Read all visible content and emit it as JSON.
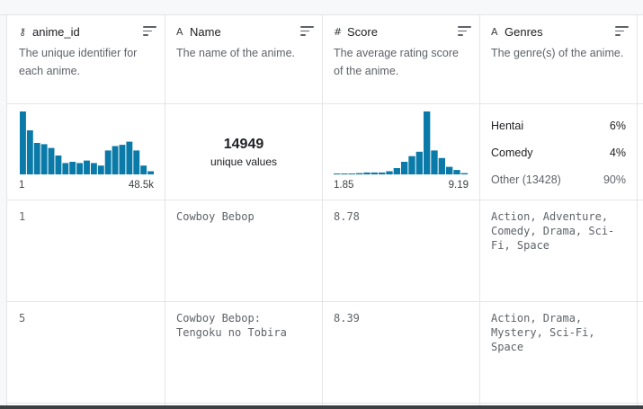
{
  "columns": [
    {
      "icon": "key-icon",
      "icon_glyph": "⚷",
      "name": "anime_id",
      "description": "The unique identifier for each anime."
    },
    {
      "icon": "text-type-icon",
      "icon_glyph": "A",
      "name": "Name",
      "description": "The name of the anime."
    },
    {
      "icon": "hash-icon",
      "icon_glyph": "#",
      "name": "Score",
      "description": "The average rating score of the anime."
    },
    {
      "icon": "text-type-icon",
      "icon_glyph": "A",
      "name": "Genres",
      "description": "The genre(s) of the anime."
    }
  ],
  "summaries": {
    "anime_id": {
      "histogram": [
        1.0,
        0.7,
        0.5,
        0.48,
        0.42,
        0.3,
        0.18,
        0.2,
        0.18,
        0.22,
        0.18,
        0.14,
        0.38,
        0.45,
        0.47,
        0.52,
        0.38,
        0.14,
        0.05
      ],
      "min_label": "1",
      "max_label": "48.5k"
    },
    "name": {
      "unique_count": "14949",
      "unique_label": "unique values"
    },
    "score": {
      "histogram": [
        0.01,
        0.01,
        0.01,
        0.02,
        0.03,
        0.03,
        0.03,
        0.05,
        0.1,
        0.2,
        0.29,
        0.36,
        1.0,
        0.38,
        0.26,
        0.12,
        0.07,
        0.02
      ],
      "min_label": "1.85",
      "max_label": "9.19"
    },
    "genres": {
      "categories": [
        {
          "label": "Hentai",
          "pct": "6%"
        },
        {
          "label": "Comedy",
          "pct": "4%"
        },
        {
          "label": "Other (13428)",
          "pct": "90%"
        }
      ]
    }
  },
  "rows": [
    {
      "anime_id": "1",
      "name": "Cowboy Bebop",
      "score": "8.78",
      "genres": [
        "Action, Adventure,",
        "Comedy, Drama, Sci-",
        "Fi, Space"
      ]
    },
    {
      "anime_id": "5",
      "name_lines": [
        "Cowboy Bebop:",
        "Tengoku no Tobira"
      ],
      "score": "8.39",
      "genres": [
        "Action, Drama,",
        "Mystery, Sci-Fi,",
        "Space"
      ]
    }
  ],
  "colors": {
    "bar": "#0a7aa8",
    "border": "#e3e5e8",
    "muted": "#5f6368"
  }
}
